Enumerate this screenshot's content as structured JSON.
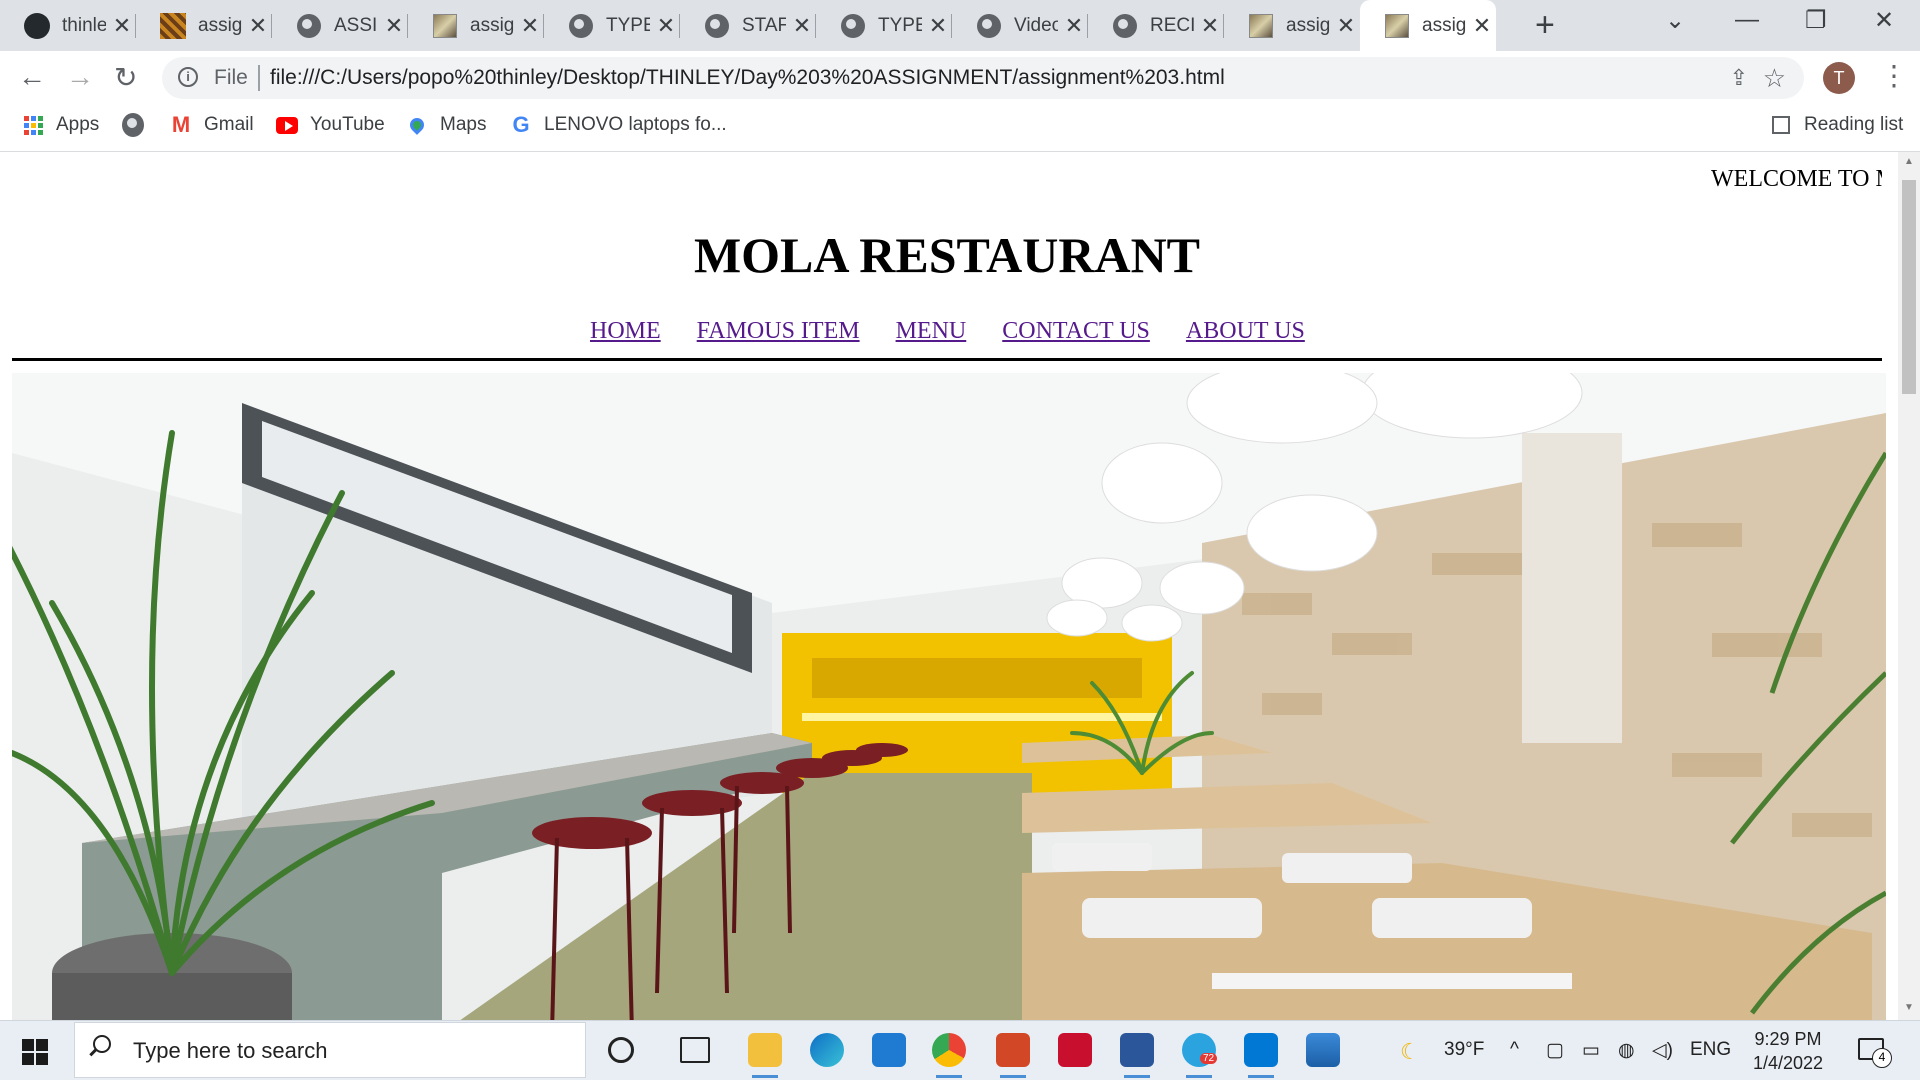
{
  "browser": {
    "tabs": [
      {
        "icon": "github-icon",
        "title": "thinley"
      },
      {
        "icon": "image-thumb-icon",
        "title": "assignment"
      },
      {
        "icon": "globe-icon",
        "title": "ASSIGNMENT"
      },
      {
        "icon": "image-thumb-icon",
        "title": "assignment"
      },
      {
        "icon": "globe-icon",
        "title": "TYPES"
      },
      {
        "icon": "globe-icon",
        "title": "STAFF"
      },
      {
        "icon": "globe-icon",
        "title": "TYPES"
      },
      {
        "icon": "globe-icon",
        "title": "Video"
      },
      {
        "icon": "globe-icon",
        "title": "RECIPE"
      },
      {
        "icon": "image-thumb-icon",
        "title": "assignment"
      },
      {
        "icon": "image-thumb-icon",
        "title": "assignment",
        "active": true
      }
    ],
    "close_glyph": "✕",
    "new_tab_glyph": "+",
    "address": {
      "scheme_label": "File",
      "url": "file:///C:/Users/popo%20thinley/Desktop/THINLEY/Day%203%20ASSIGNMENT/assignment%203.html"
    },
    "profile_initial": "T",
    "bookmarks": [
      {
        "label": "Apps",
        "icon": "apps-grid-icon"
      },
      {
        "label": "",
        "icon": "globe-icon"
      },
      {
        "label": "Gmail",
        "icon": "gmail-icon"
      },
      {
        "label": "YouTube",
        "icon": "youtube-icon"
      },
      {
        "label": "Maps",
        "icon": "maps-icon"
      },
      {
        "label": "LENOVO laptops fo...",
        "icon": "google-icon"
      }
    ],
    "reading_list": "Reading list"
  },
  "page": {
    "marquee": "WELCOME TO MOLA RESTAURANT",
    "title": "MOLA RESTAURANT",
    "nav": [
      "HOME",
      "FAMOUS ITEM",
      "MENU",
      "CONTACT US",
      "ABOUT US"
    ]
  },
  "taskbar": {
    "search_placeholder": "Type here to search",
    "apps": [
      "cortana-icon",
      "task-view-icon",
      "file-explorer-icon",
      "edge-icon",
      "mail-icon",
      "chrome-icon",
      "powerpoint-icon",
      "vector-app-icon",
      "word-icon",
      "telegram-icon",
      "vscode-icon",
      "photos-icon"
    ],
    "telegram_badge": "72",
    "weather": "39°F",
    "language": "ENG",
    "time": "9:29 PM",
    "date": "1/4/2022",
    "notification_count": "4"
  },
  "colors": {
    "tab_strip": "#dee1e6",
    "link_visited": "#551a8b",
    "taskbar": "#e9eef4",
    "kitchen_yellow": "#f2c200",
    "stool_red": "#7a1f24"
  }
}
